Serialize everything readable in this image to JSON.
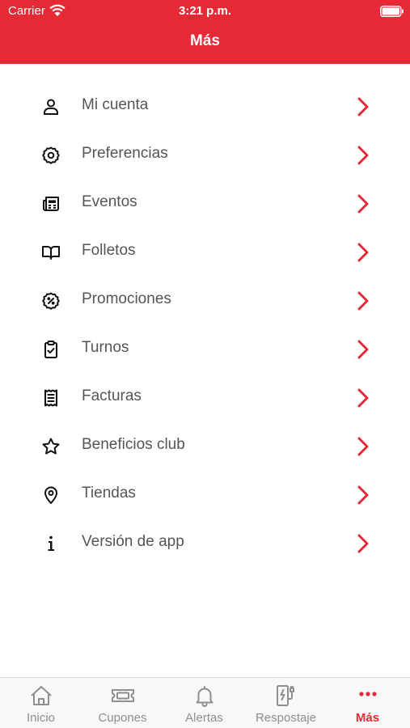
{
  "status_bar": {
    "carrier": "Carrier",
    "time": "3:21 p.m."
  },
  "header": {
    "title": "Más"
  },
  "menu": {
    "items": [
      {
        "label": "Mi cuenta",
        "icon": "user-icon"
      },
      {
        "label": "Preferencias",
        "icon": "gear-icon"
      },
      {
        "label": "Eventos",
        "icon": "newspaper-icon"
      },
      {
        "label": "Folletos",
        "icon": "book-icon"
      },
      {
        "label": "Promociones",
        "icon": "discount-badge-icon"
      },
      {
        "label": "Turnos",
        "icon": "clipboard-check-icon"
      },
      {
        "label": "Facturas",
        "icon": "receipt-icon"
      },
      {
        "label": "Beneficios club",
        "icon": "star-icon"
      },
      {
        "label": "Tiendas",
        "icon": "map-pin-icon"
      },
      {
        "label": "Versión de app",
        "icon": "info-icon"
      }
    ]
  },
  "tabbar": {
    "tabs": [
      {
        "label": "Inicio",
        "icon": "home-icon"
      },
      {
        "label": "Cupones",
        "icon": "ticket-icon"
      },
      {
        "label": "Alertas",
        "icon": "bell-icon"
      },
      {
        "label": "Respostaje",
        "icon": "fuel-charger-icon"
      },
      {
        "label": "Más",
        "icon": "more-dots-icon"
      }
    ],
    "active": "Más"
  },
  "colors": {
    "brand": "#e52a35",
    "text": "#555555",
    "inactive_tab": "#8e8e93"
  }
}
